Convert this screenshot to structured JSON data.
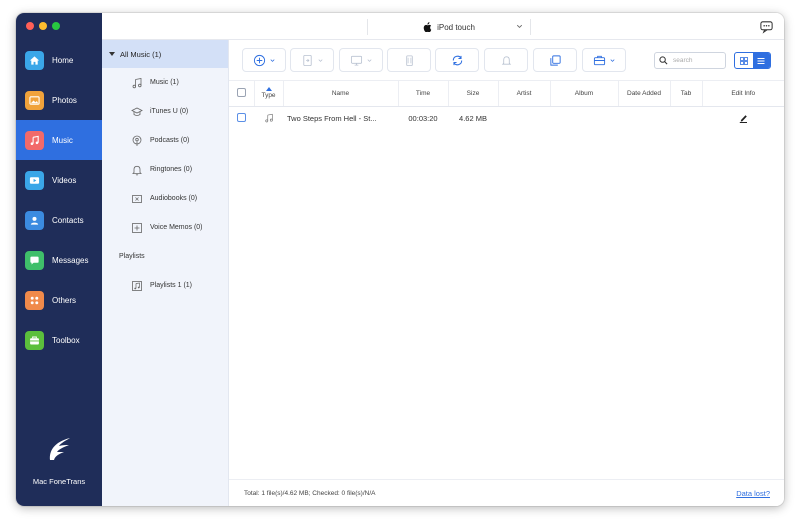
{
  "app": {
    "name": "Mac FoneTrans"
  },
  "colors": {
    "sidebar": "#1f2d59",
    "accent": "#2f6fe0",
    "tree_bg": "#f1f4fb",
    "tree_selected": "#d3e0f7"
  },
  "window_controls": [
    "close",
    "minimize",
    "zoom"
  ],
  "header": {
    "device_name": "iPod touch",
    "device_icon": "apple-icon",
    "chat_icon": "chat-bubble-icon"
  },
  "sidebar": {
    "items": [
      {
        "label": "Home",
        "icon": "home-icon",
        "color": "#3aa6e8",
        "active": false
      },
      {
        "label": "Photos",
        "icon": "photos-icon",
        "color": "#f0a23b",
        "active": false
      },
      {
        "label": "Music",
        "icon": "music-icon",
        "color": "#f26a6a",
        "active": true
      },
      {
        "label": "Videos",
        "icon": "videos-icon",
        "color": "#3aa6e8",
        "active": false
      },
      {
        "label": "Contacts",
        "icon": "contacts-icon",
        "color": "#3b8be0",
        "active": false
      },
      {
        "label": "Messages",
        "icon": "messages-icon",
        "color": "#3fbf6a",
        "active": false
      },
      {
        "label": "Others",
        "icon": "others-icon",
        "color": "#f08a4b",
        "active": false
      },
      {
        "label": "Toolbox",
        "icon": "toolbox-icon",
        "color": "#5bbf3c",
        "active": false
      }
    ]
  },
  "tree": {
    "root": "All Music (1)",
    "items": [
      {
        "label": "Music (1)",
        "icon": "music-note-icon"
      },
      {
        "label": "iTunes U (0)",
        "icon": "graduation-cap-icon"
      },
      {
        "label": "Podcasts (0)",
        "icon": "podcast-icon"
      },
      {
        "label": "Ringtones (0)",
        "icon": "bell-icon"
      },
      {
        "label": "Audiobooks (0)",
        "icon": "audiobook-icon"
      },
      {
        "label": "Voice Memos (0)",
        "icon": "voice-memo-icon"
      }
    ],
    "playlists_header": "Playlists",
    "playlists": [
      {
        "label": "Playlists 1 (1)",
        "icon": "playlist-icon"
      }
    ]
  },
  "toolbar": {
    "buttons": [
      "add-icon",
      "export-to-device-icon",
      "export-to-pc-icon",
      "delete-icon",
      "sync-icon",
      "ringtone-icon",
      "copy-icon",
      "toolbox-icon"
    ],
    "search_placeholder": "search",
    "view_modes": [
      "grid",
      "list"
    ],
    "selected_view": "list"
  },
  "table": {
    "columns": [
      "Type",
      "Name",
      "Time",
      "Size",
      "Artist",
      "Album",
      "Date Added",
      "Tab",
      "Edit Info"
    ],
    "rows": [
      {
        "name": "Two Steps From Hell - St...",
        "time": "00:03:20",
        "size": "4.62 MB",
        "artist": "",
        "album": "",
        "date_added": "",
        "tab": ""
      }
    ]
  },
  "footer": {
    "status": "Total: 1 file(s)/4.62 MB; Checked: 0 file(s)/N/A",
    "link": "Data lost?"
  }
}
